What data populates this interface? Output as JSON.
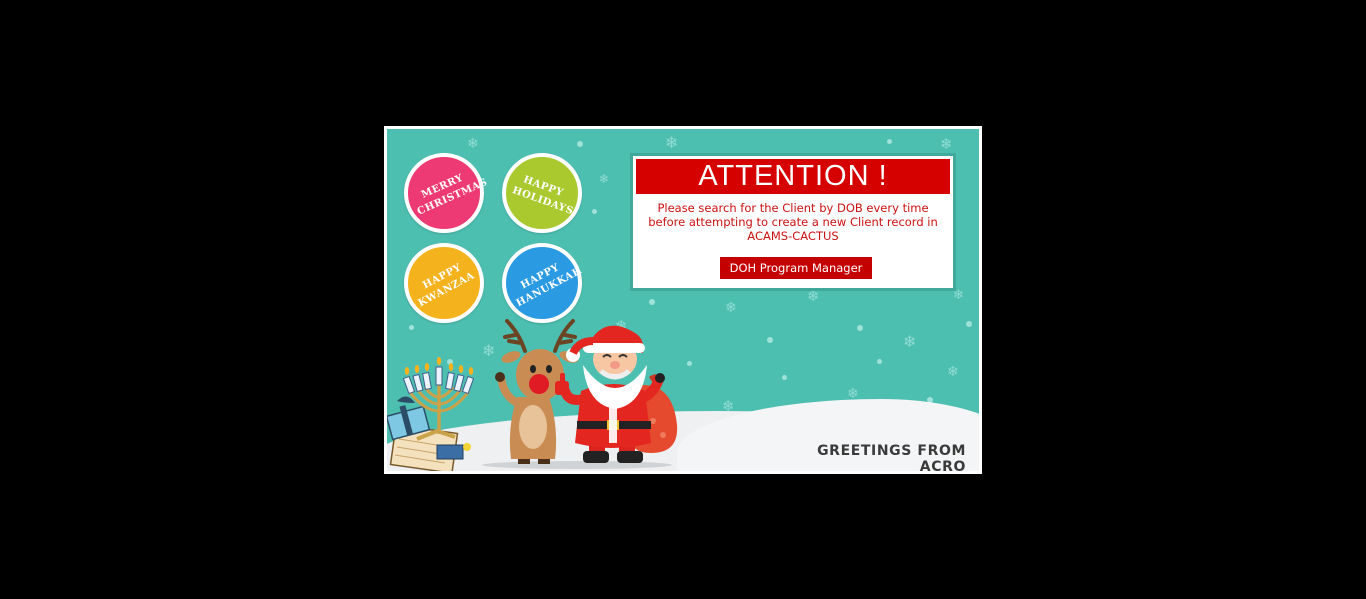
{
  "greeting_circles": [
    {
      "line1": "MERRY",
      "line2": "CHRISTMAS",
      "color": "#ee3a74"
    },
    {
      "line1": "HAPPY",
      "line2": "HOLIDAYS",
      "color": "#a9c92f"
    },
    {
      "line1": "HAPPY",
      "line2": "KWANZAA",
      "color": "#f4b21d"
    },
    {
      "line1": "HAPPY",
      "line2": "HANUKKAH",
      "color": "#2a9ae2"
    }
  ],
  "attention": {
    "title": "ATTENTION !",
    "message": "Please search for the Client by DOB every time before attempting to create a new Client record in ACAMS-CACTUS",
    "button_label": "DOH Program Manager"
  },
  "footer": {
    "greeting": "GREETINGS FROM ACRO"
  },
  "colors": {
    "card_background": "#4dbfb1",
    "attention_red": "#d50000",
    "button_red": "#c40000",
    "snow": "#eef0f1"
  },
  "illustration": {
    "icons": [
      "reindeer-icon",
      "santa-icon",
      "menorah-icon",
      "gift-box-icon",
      "snowflake-icon"
    ]
  }
}
